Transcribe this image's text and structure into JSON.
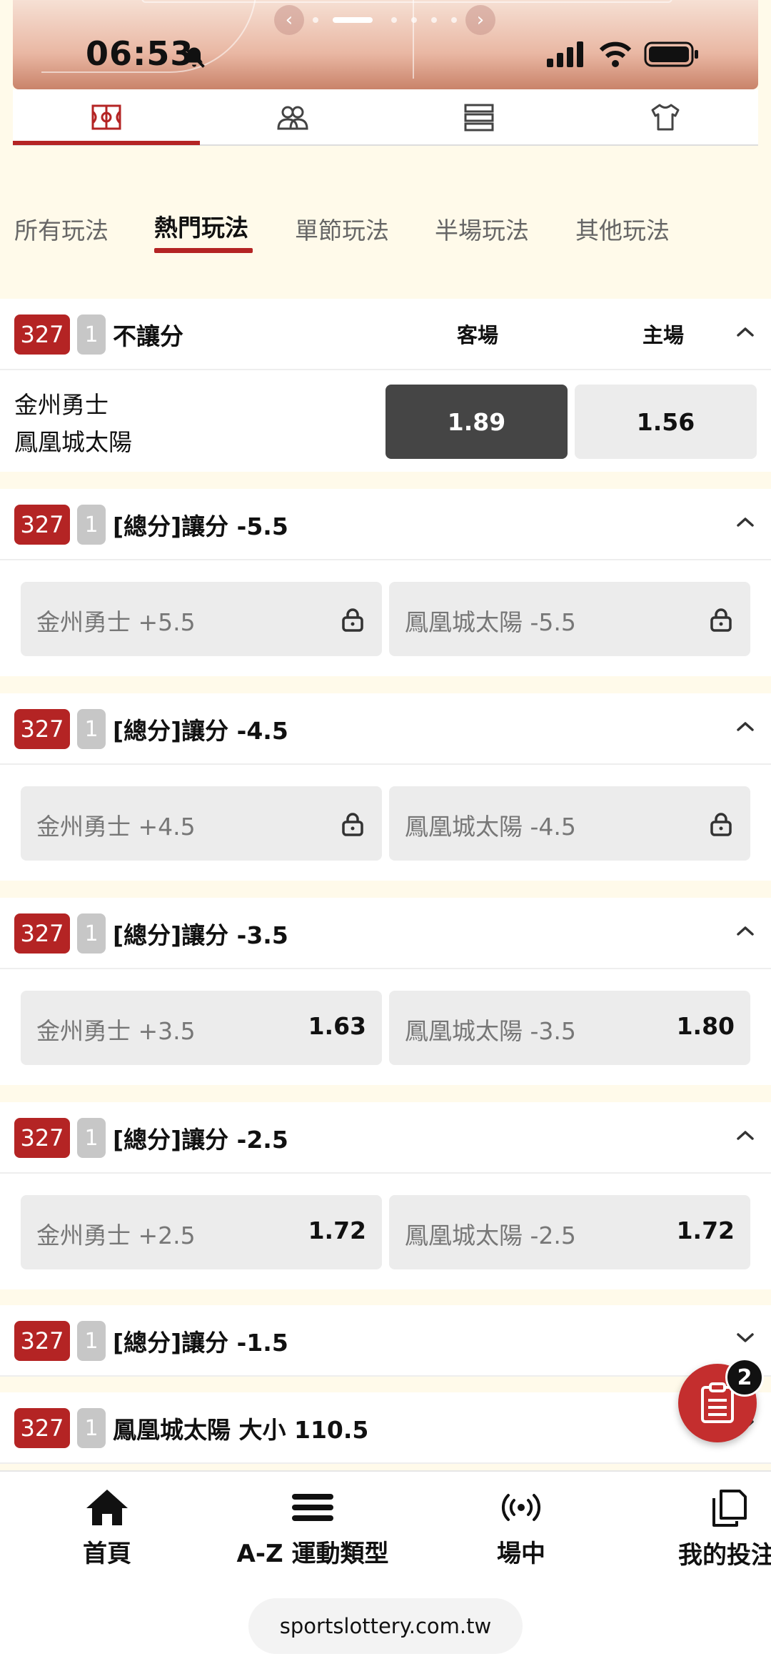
{
  "status_bar": {
    "time": "06:53"
  },
  "play_tabs": [
    "所有玩法",
    "熱門玩法",
    "單節玩法",
    "半場玩法",
    "其他玩法"
  ],
  "moneyline": {
    "match_id": "327",
    "quarter": "1",
    "title": "不讓分",
    "col_away": "客場",
    "col_home": "主場",
    "team_away": "金州勇士",
    "team_home": "鳳凰城太陽",
    "odds_away": "1.89",
    "odds_home": "1.56"
  },
  "markets": [
    {
      "match_id": "327",
      "quarter": "1",
      "title": "[總分]讓分 -5.5",
      "left_label": "金州勇士 +5.5",
      "right_label": "鳳凰城太陽 -5.5",
      "left_odds": "",
      "right_odds": "",
      "locked": true
    },
    {
      "match_id": "327",
      "quarter": "1",
      "title": "[總分]讓分 -4.5",
      "left_label": "金州勇士 +4.5",
      "right_label": "鳳凰城太陽 -4.5",
      "left_odds": "",
      "right_odds": "",
      "locked": true
    },
    {
      "match_id": "327",
      "quarter": "1",
      "title": "[總分]讓分 -3.5",
      "left_label": "金州勇士 +3.5",
      "right_label": "鳳凰城太陽 -3.5",
      "left_odds": "1.63",
      "right_odds": "1.80",
      "locked": false
    },
    {
      "match_id": "327",
      "quarter": "1",
      "title": "[總分]讓分 -2.5",
      "left_label": "金州勇士 +2.5",
      "right_label": "鳳凰城太陽 -2.5",
      "left_odds": "1.72",
      "right_odds": "1.72",
      "locked": false
    }
  ],
  "collapsed_markets": [
    {
      "match_id": "327",
      "quarter": "1",
      "title": "[總分]讓分 -1.5"
    },
    {
      "match_id": "327",
      "quarter": "1",
      "title": "鳳凰城太陽 大小 110.5"
    }
  ],
  "bet_slip": {
    "count": "2"
  },
  "bottom_nav": [
    {
      "label": "首頁",
      "icon": "home-icon"
    },
    {
      "label": "A-Z 運動類型",
      "icon": "menu-icon"
    },
    {
      "label": "場中",
      "icon": "live-broadcast-icon"
    },
    {
      "label": "我的投注",
      "icon": "document-stack-icon"
    }
  ],
  "url": "sportslottery.com.tw",
  "colors": {
    "accent": "#b42424",
    "selected_odds": "#454545"
  }
}
